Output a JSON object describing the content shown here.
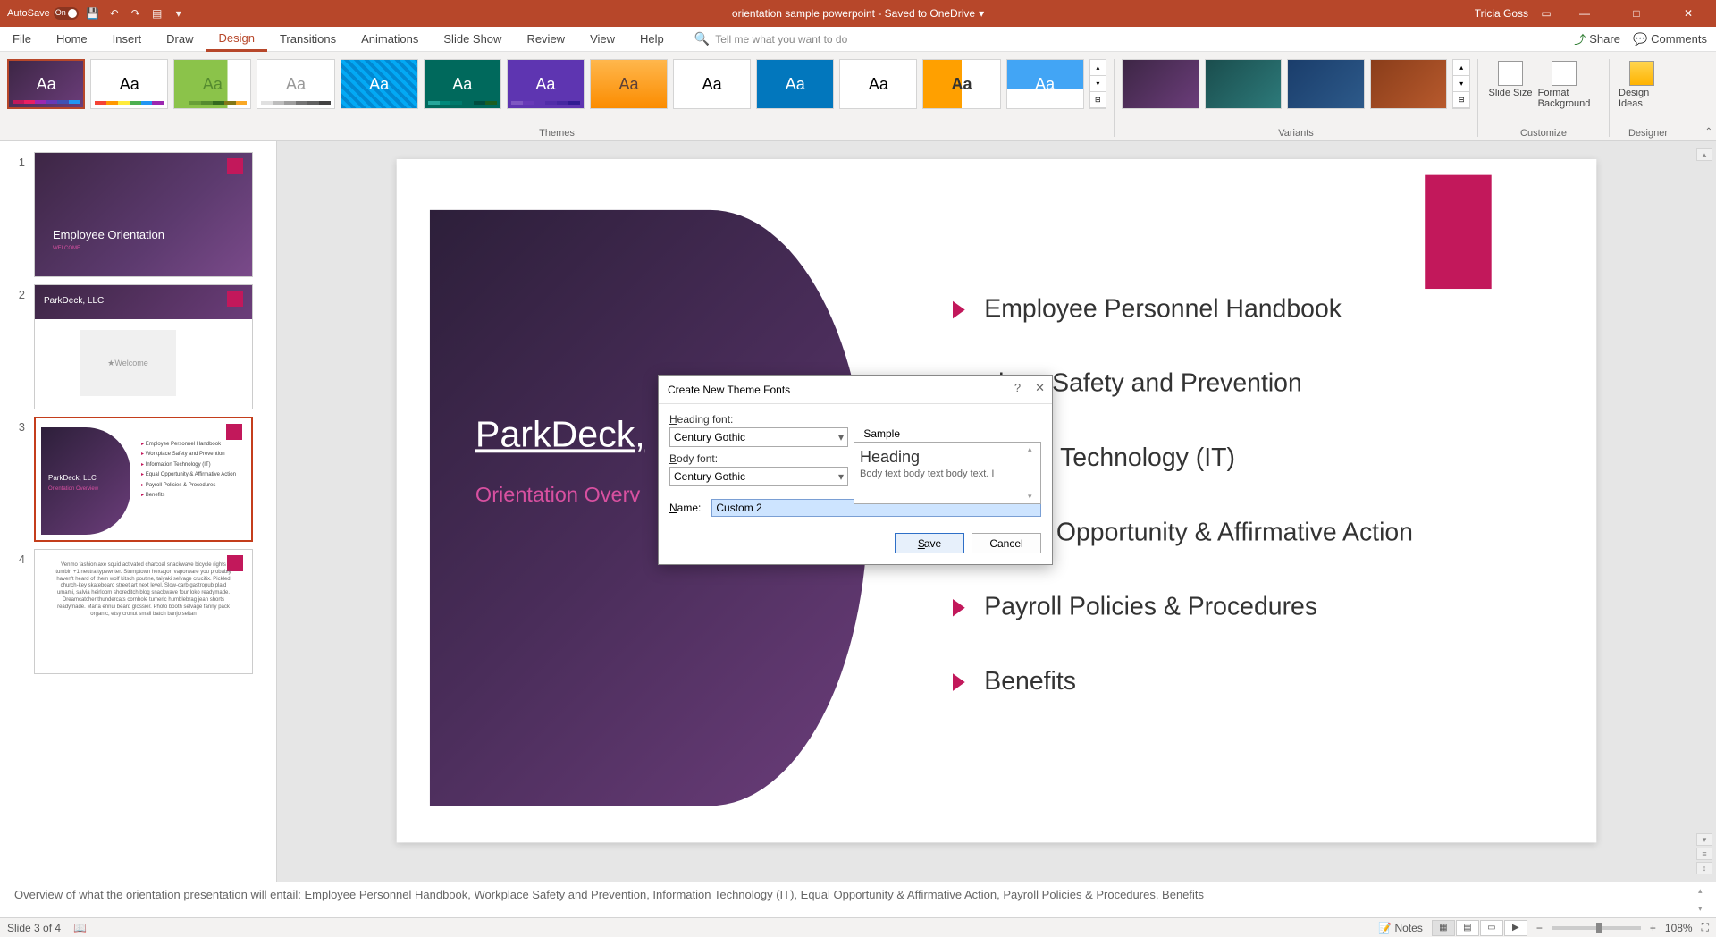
{
  "titlebar": {
    "autosave": "AutoSave",
    "autosave_state": "On",
    "doc_title": "orientation sample powerpoint - Saved to OneDrive",
    "user": "Tricia Goss"
  },
  "tabs": {
    "file": "File",
    "home": "Home",
    "insert": "Insert",
    "draw": "Draw",
    "design": "Design",
    "transitions": "Transitions",
    "animations": "Animations",
    "slideshow": "Slide Show",
    "review": "Review",
    "view": "View",
    "help": "Help",
    "tellme": "Tell me what you want to do",
    "share": "Share",
    "comments": "Comments"
  },
  "ribbon": {
    "themes_label": "Themes",
    "variants_label": "Variants",
    "customize_label": "Customize",
    "designer_label": "Designer",
    "slide_size": "Slide Size",
    "format_bg": "Format Background",
    "design_ideas": "Design Ideas"
  },
  "thumbs": {
    "s1_title": "Employee Orientation",
    "s1_sub": "WELCOME",
    "s2_title": "ParkDeck, LLC",
    "s2_welcome": "Welcome",
    "s3_title": "ParkDeck, LLC",
    "s3_sub": "Orientation Overview",
    "s3_b1": "Employee Personnel Handbook",
    "s3_b2": "Workplace Safety and Prevention",
    "s3_b3": "Information Technology (IT)",
    "s3_b4": "Equal Opportunity & Affirmative Action",
    "s3_b5": "Payroll Policies & Procedures",
    "s3_b6": "Benefits",
    "s4_text": "Venmo fashion axe squid activated charcoal snackwave bicycle rights tumblr, +1 neutra typewriter. Stumptown hexagon vaporware you probably haven't heard of them wolf kitsch poutine, taiyaki selvage crucifix. Pickled church-key skateboard street art next level. Slow-carb gastropub plaid umami, salvia heirloom shoreditch blog snackwave four loko readymade. Dreamcatcher thundercats cornhole tumeric humblebrag jean shorts readymade. Marfa ennui beard glossier. Photo booth selvage fanny pack organic, etsy cronut small batch banjo seitan"
  },
  "slide": {
    "title": "ParkDeck,",
    "subtitle": "Orientation Overv",
    "bullets": [
      "Employee Personnel Handbook",
      "place Safety and Prevention",
      "nation Technology (IT)",
      "Equal Opportunity & Affirmative Action",
      "Payroll Policies & Procedures",
      "Benefits"
    ]
  },
  "dialog": {
    "title": "Create New Theme Fonts",
    "heading_label": "Heading font:",
    "heading_value": "Century Gothic",
    "body_label": "Body font:",
    "body_value": "Century Gothic",
    "sample_label": "Sample",
    "sample_heading": "Heading",
    "sample_body": "Body text body text body text. I",
    "name_label": "Name:",
    "name_value": "Custom 2",
    "save": "Save",
    "cancel": "Cancel"
  },
  "notes": {
    "text": "Overview of what the orientation presentation will entail: Employee Personnel Handbook, Workplace Safety and Prevention, Information Technology (IT), Equal Opportunity & Affirmative Action, Payroll Policies & Procedures, Benefits"
  },
  "status": {
    "slide": "Slide 3 of 4",
    "notes": "Notes",
    "zoom": "108%"
  }
}
